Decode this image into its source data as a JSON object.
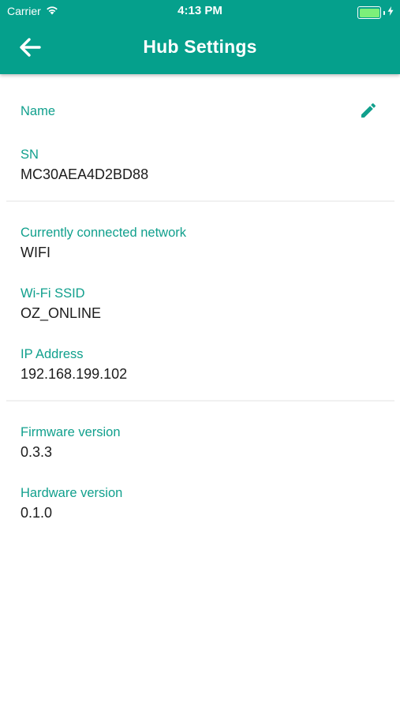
{
  "status_bar": {
    "carrier": "Carrier",
    "time": "4:13 PM"
  },
  "header": {
    "title": "Hub Settings",
    "back_icon": "arrow-left-icon"
  },
  "device": {
    "name_label": "Name",
    "edit_icon": "pencil-icon",
    "sn_label": "SN",
    "sn_value": "MC30AEA4D2BD88"
  },
  "network": {
    "connected_label": "Currently connected network",
    "connected_value": "WIFI",
    "ssid_label": "Wi-Fi SSID",
    "ssid_value": "OZ_ONLINE",
    "ip_label": "IP Address",
    "ip_value": "192.168.199.102"
  },
  "versions": {
    "firmware_label": "Firmware version",
    "firmware_value": "0.3.3",
    "hardware_label": "Hardware version",
    "hardware_value": "0.1.0"
  },
  "colors": {
    "accent": "#05a08c",
    "label": "#11a08d",
    "text": "#1c1c1c",
    "divider": "#f1f1f1"
  }
}
